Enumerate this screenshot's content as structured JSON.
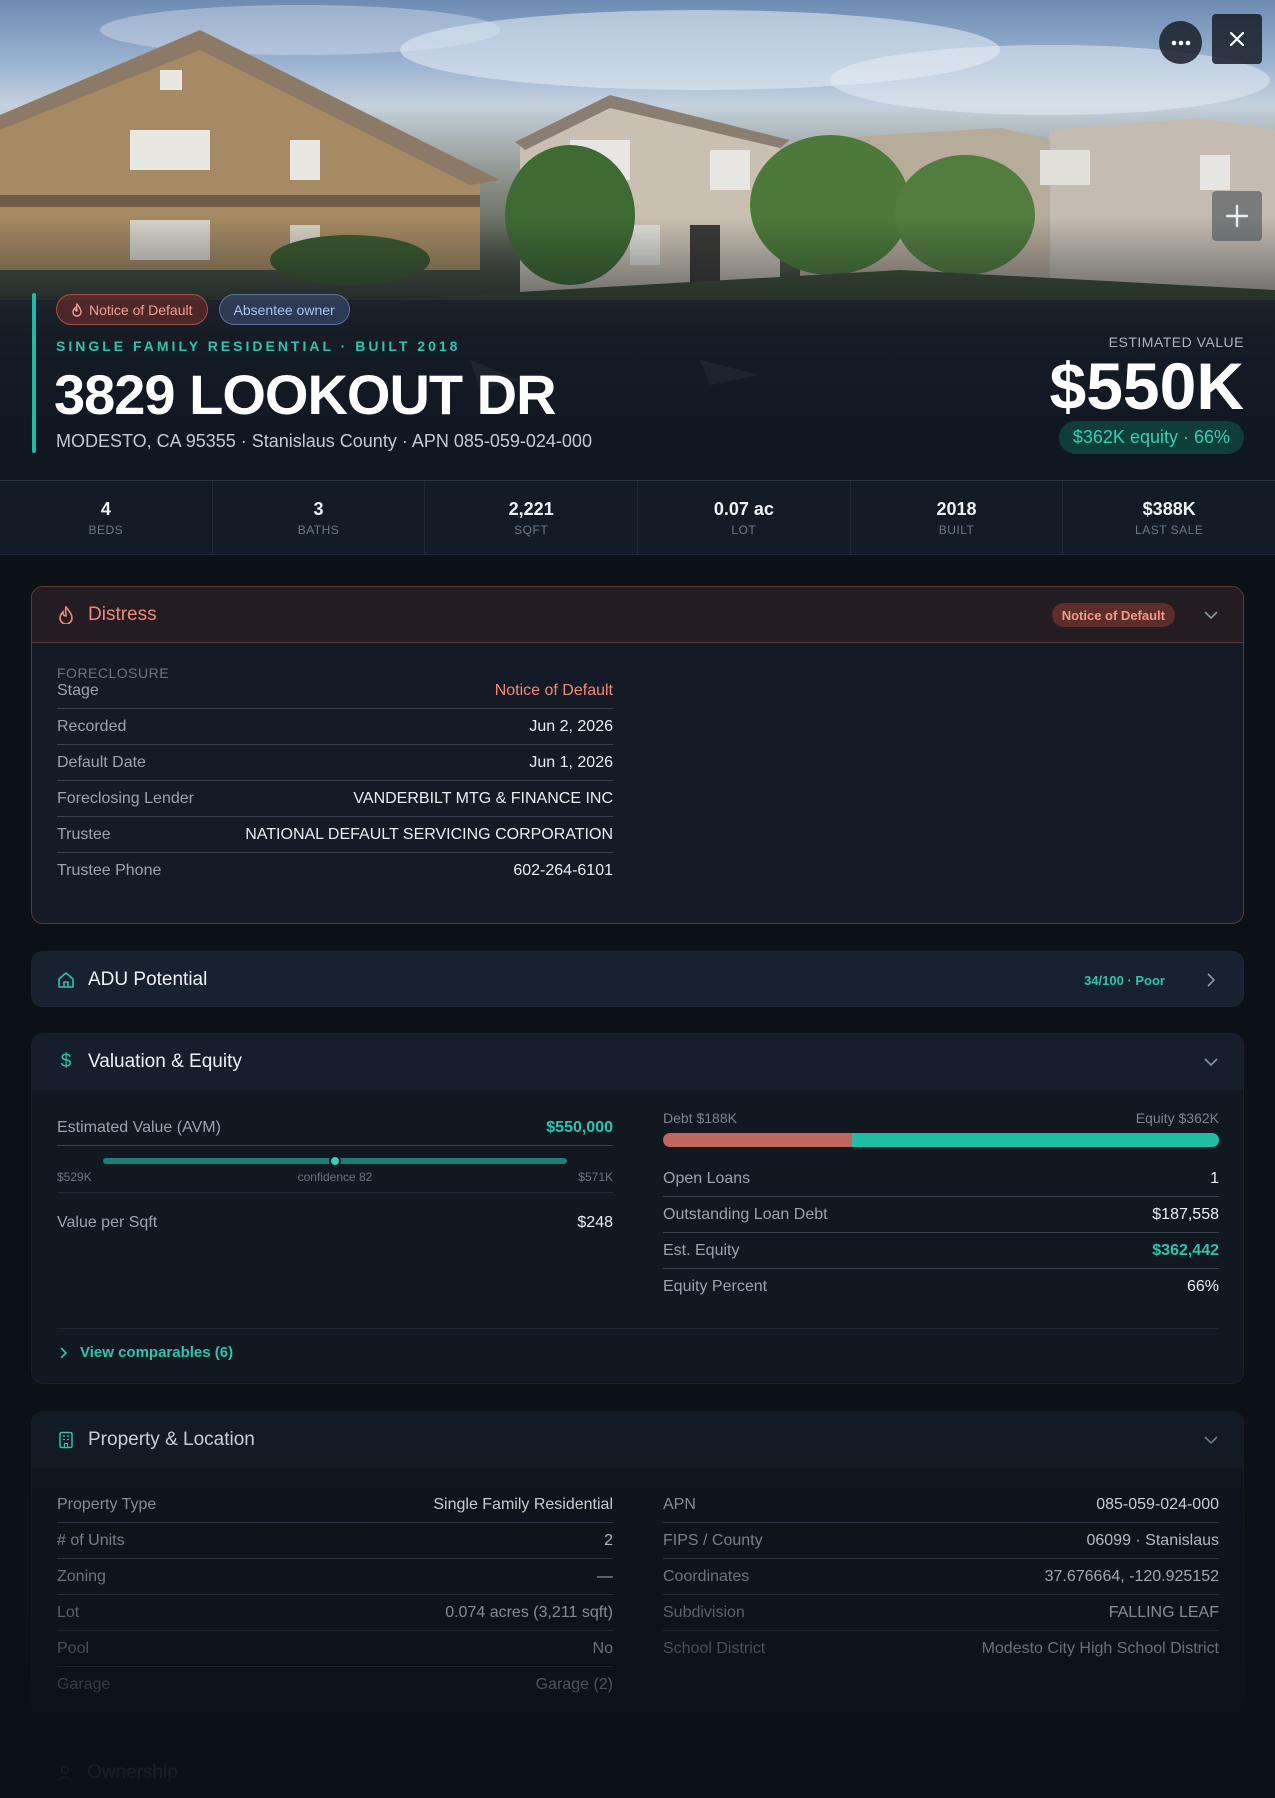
{
  "hero": {
    "tags": [
      "Notice of Default",
      "Absentee owner"
    ],
    "subtitle": "SINGLE FAMILY RESIDENTIAL · BUILT 2018",
    "address": "3829 LOOKOUT DR",
    "location_line": "MODESTO, CA 95355 · Stanislaus County · APN 085-059-024-000",
    "estimated_value_label": "ESTIMATED VALUE",
    "estimated_value": "$550K",
    "equity_pill": "$362K equity · 66%"
  },
  "stats": [
    {
      "value": "4",
      "label": "BEDS"
    },
    {
      "value": "3",
      "label": "BATHS"
    },
    {
      "value": "2,221",
      "label": "SQFT"
    },
    {
      "value": "0.07 ac",
      "label": "LOT"
    },
    {
      "value": "2018",
      "label": "BUILT"
    },
    {
      "value": "$388K",
      "label": "LAST SALE"
    }
  ],
  "distress": {
    "title": "Distress",
    "badge": "Notice of Default",
    "section": "FORECLOSURE",
    "rows": [
      {
        "k": "Stage",
        "v": "Notice of Default"
      },
      {
        "k": "Recorded",
        "v": "Jun 2, 2026"
      },
      {
        "k": "Default Date",
        "v": "Jun 1, 2026"
      },
      {
        "k": "Foreclosing Lender",
        "v": "VANDERBILT MTG & FINANCE INC"
      },
      {
        "k": "Trustee",
        "v": "NATIONAL DEFAULT SERVICING CORPORATION"
      },
      {
        "k": "Trustee Phone",
        "v": "602-264-6101"
      }
    ]
  },
  "adu": {
    "title": "ADU Potential",
    "badge": "34/100 · Poor"
  },
  "valuation": {
    "title": "Valuation & Equity",
    "avm_label": "Estimated Value (AVM)",
    "avm_value": "$550,000",
    "range_low": "$529K",
    "range_high": "$571K",
    "confidence": "confidence 82",
    "range_position": 0.5,
    "per_sqft_label": "Value per Sqft",
    "per_sqft_value": "$248",
    "debt_label": "Debt $188K",
    "equity_label": "Equity $362K",
    "debt_fraction": 0.34,
    "rows": [
      {
        "k": "Open Loans",
        "v": "1"
      },
      {
        "k": "Outstanding Loan Debt",
        "v": "$187,558"
      },
      {
        "k": "Est. Equity",
        "v": "$362,442"
      },
      {
        "k": "Equity Percent",
        "v": "66%"
      }
    ],
    "comparables": "View comparables (6)"
  },
  "property": {
    "title": "Property & Location",
    "left": [
      {
        "k": "Property Type",
        "v": "Single Family Residential"
      },
      {
        "k": "# of Units",
        "v": "2"
      },
      {
        "k": "Zoning",
        "v": "—"
      },
      {
        "k": "Lot",
        "v": "0.074 acres (3,211 sqft)"
      },
      {
        "k": "Pool",
        "v": "No"
      },
      {
        "k": "Garage",
        "v": "Garage (2)"
      }
    ],
    "right": [
      {
        "k": "APN",
        "v": "085-059-024-000"
      },
      {
        "k": "FIPS / County",
        "v": "06099 · Stanislaus"
      },
      {
        "k": "Coordinates",
        "v": "37.676664, -120.925152"
      },
      {
        "k": "Subdivision",
        "v": "FALLING LEAF"
      },
      {
        "k": "School District",
        "v": "Modesto City High School District"
      }
    ]
  },
  "ownership": {
    "title": "Ownership"
  },
  "colors": {
    "accent": "#22b8a4",
    "distress": "#f08a78",
    "debt": "#c0665c",
    "equity": "#1fbfa6"
  }
}
